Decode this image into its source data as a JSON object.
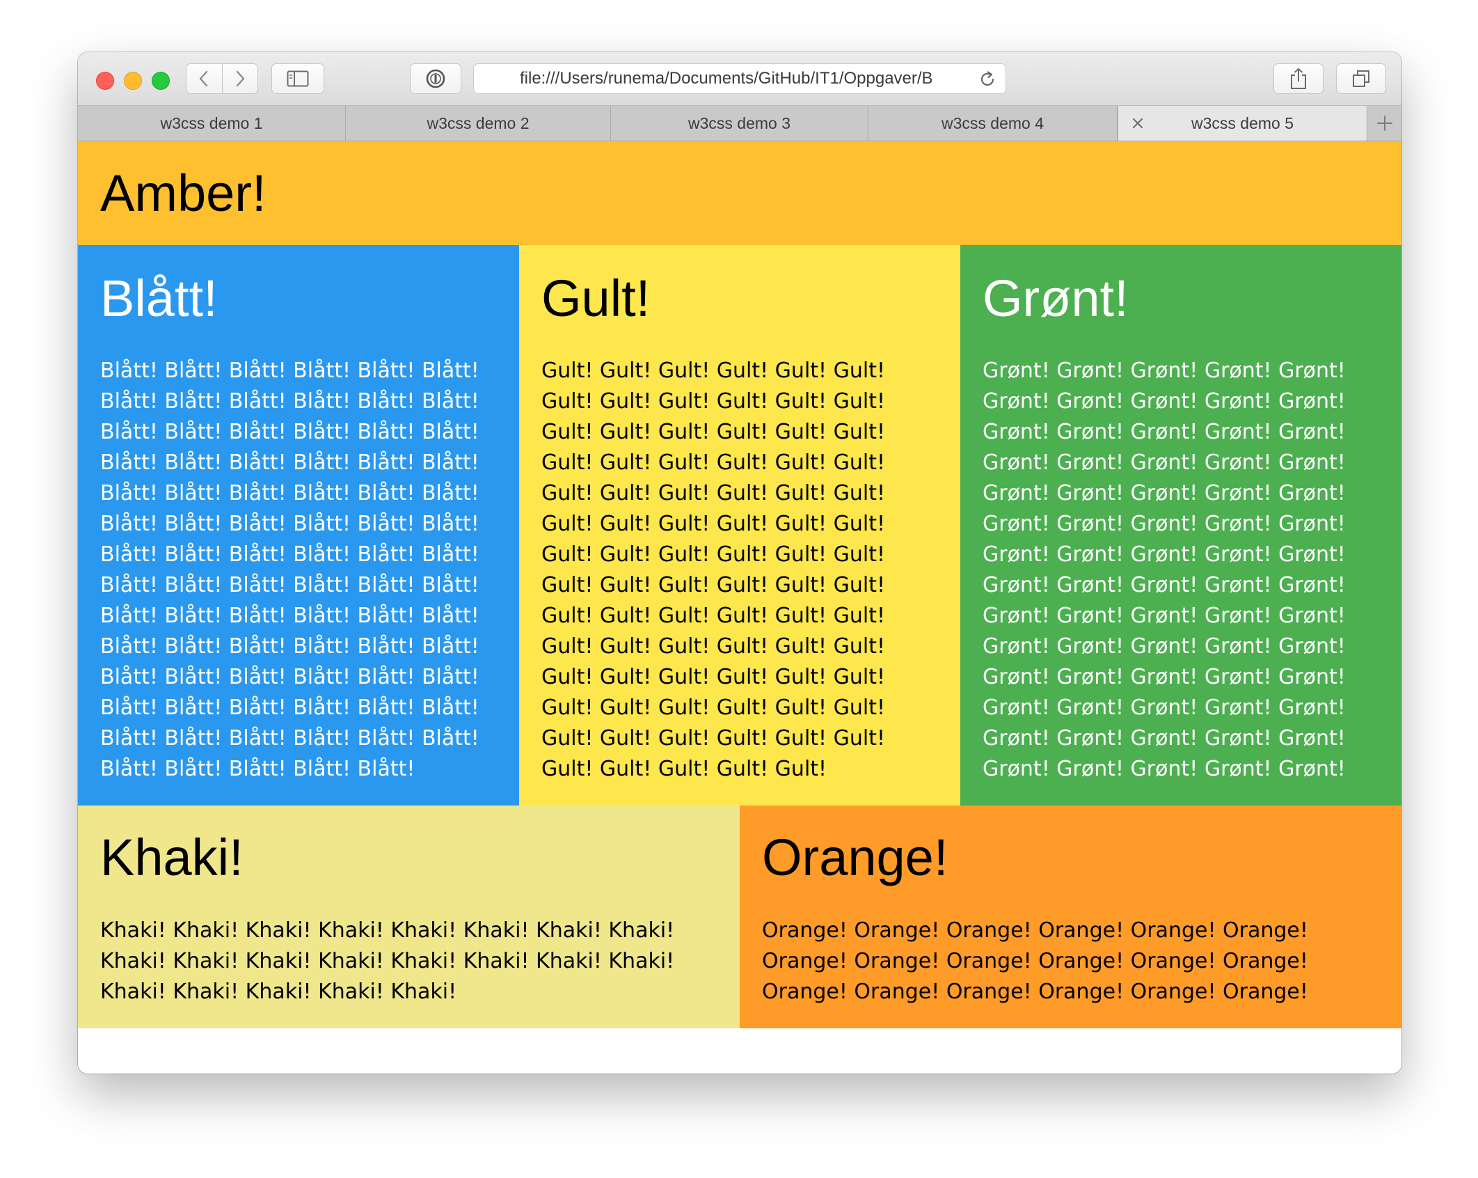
{
  "browser": {
    "url": "file:///Users/runema/Documents/GitHub/IT1/Oppgaver/B",
    "tabs": [
      {
        "label": "w3css demo 1",
        "active": false
      },
      {
        "label": "w3css demo 2",
        "active": false
      },
      {
        "label": "w3css demo 3",
        "active": false
      },
      {
        "label": "w3css demo 4",
        "active": false
      },
      {
        "label": "w3css demo 5",
        "active": true
      }
    ]
  },
  "page": {
    "amber": {
      "heading": "Amber!",
      "color": "#ffc030"
    },
    "blue": {
      "heading": "Blått!",
      "color": "#2b98f0",
      "text": "Blått! Blått! Blått! Blått! Blått! Blått! Blått! Blått! Blått! Blått! Blått! Blått! Blått! Blått! Blått! Blått! Blått! Blått! Blått! Blått! Blått! Blått! Blått! Blått! Blått! Blått! Blått! Blått! Blått! Blått! Blått! Blått! Blått! Blått! Blått! Blått! Blått! Blått! Blått! Blått! Blått! Blått! Blått! Blått! Blått! Blått! Blått! Blått! Blått! Blått! Blått! Blått! Blått! Blått! Blått! Blått! Blått! Blått! Blått! Blått! Blått! Blått! Blått! Blått! Blått! Blått! Blått! Blått! Blått! Blått! Blått! Blått! Blått! Blått! Blått! Blått! Blått! Blått! Blått! Blått! Blått! Blått! Blått!"
    },
    "yellow": {
      "heading": "Gult!",
      "color": "#fde74c",
      "text": "Gult! Gult! Gult! Gult! Gult! Gult! Gult! Gult! Gult! Gult! Gult! Gult! Gult! Gult! Gult! Gult! Gult! Gult! Gult! Gult! Gult! Gult! Gult! Gult! Gult! Gult! Gult! Gult! Gult! Gult! Gult! Gult! Gult! Gult! Gult! Gult! Gult! Gult! Gult! Gult! Gult! Gult! Gult! Gult! Gult! Gult! Gult! Gult! Gult! Gult! Gult! Gult! Gult! Gult! Gult! Gult! Gult! Gult! Gult! Gult! Gult! Gult! Gult! Gult! Gult! Gult! Gult! Gult! Gult! Gult! Gult! Gult! Gult! Gult! Gult! Gult! Gult! Gult! Gult! Gult! Gult! Gult! Gult!"
    },
    "green": {
      "heading": "Grønt!",
      "color": "#4caf50",
      "text": "Grønt! Grønt! Grønt! Grønt! Grønt! Grønt! Grønt! Grønt! Grønt! Grønt! Grønt! Grønt! Grønt! Grønt! Grønt! Grønt! Grønt! Grønt! Grønt! Grønt! Grønt! Grønt! Grønt! Grønt! Grønt! Grønt! Grønt! Grønt! Grønt! Grønt! Grønt! Grønt! Grønt! Grønt! Grønt! Grønt! Grønt! Grønt! Grønt! Grønt! Grønt! Grønt! Grønt! Grønt! Grønt! Grønt! Grønt! Grønt! Grønt! Grønt! Grønt! Grønt! Grønt! Grønt! Grønt! Grønt! Grønt! Grønt! Grønt! Grønt! Grønt! Grønt! Grønt! Grønt! Grønt! Grønt! Grønt! Grønt! Grønt! Grønt!"
    },
    "khaki": {
      "heading": "Khaki!",
      "color": "#f0e68c",
      "text": "Khaki! Khaki! Khaki! Khaki! Khaki! Khaki! Khaki! Khaki! Khaki! Khaki! Khaki! Khaki! Khaki! Khaki! Khaki! Khaki! Khaki! Khaki! Khaki! Khaki! Khaki!"
    },
    "orange": {
      "heading": "Orange!",
      "color": "#ff9b28",
      "text": "Orange! Orange! Orange! Orange! Orange! Orange! Orange! Orange! Orange! Orange! Orange! Orange! Orange! Orange! Orange! Orange! Orange! Orange!"
    }
  }
}
